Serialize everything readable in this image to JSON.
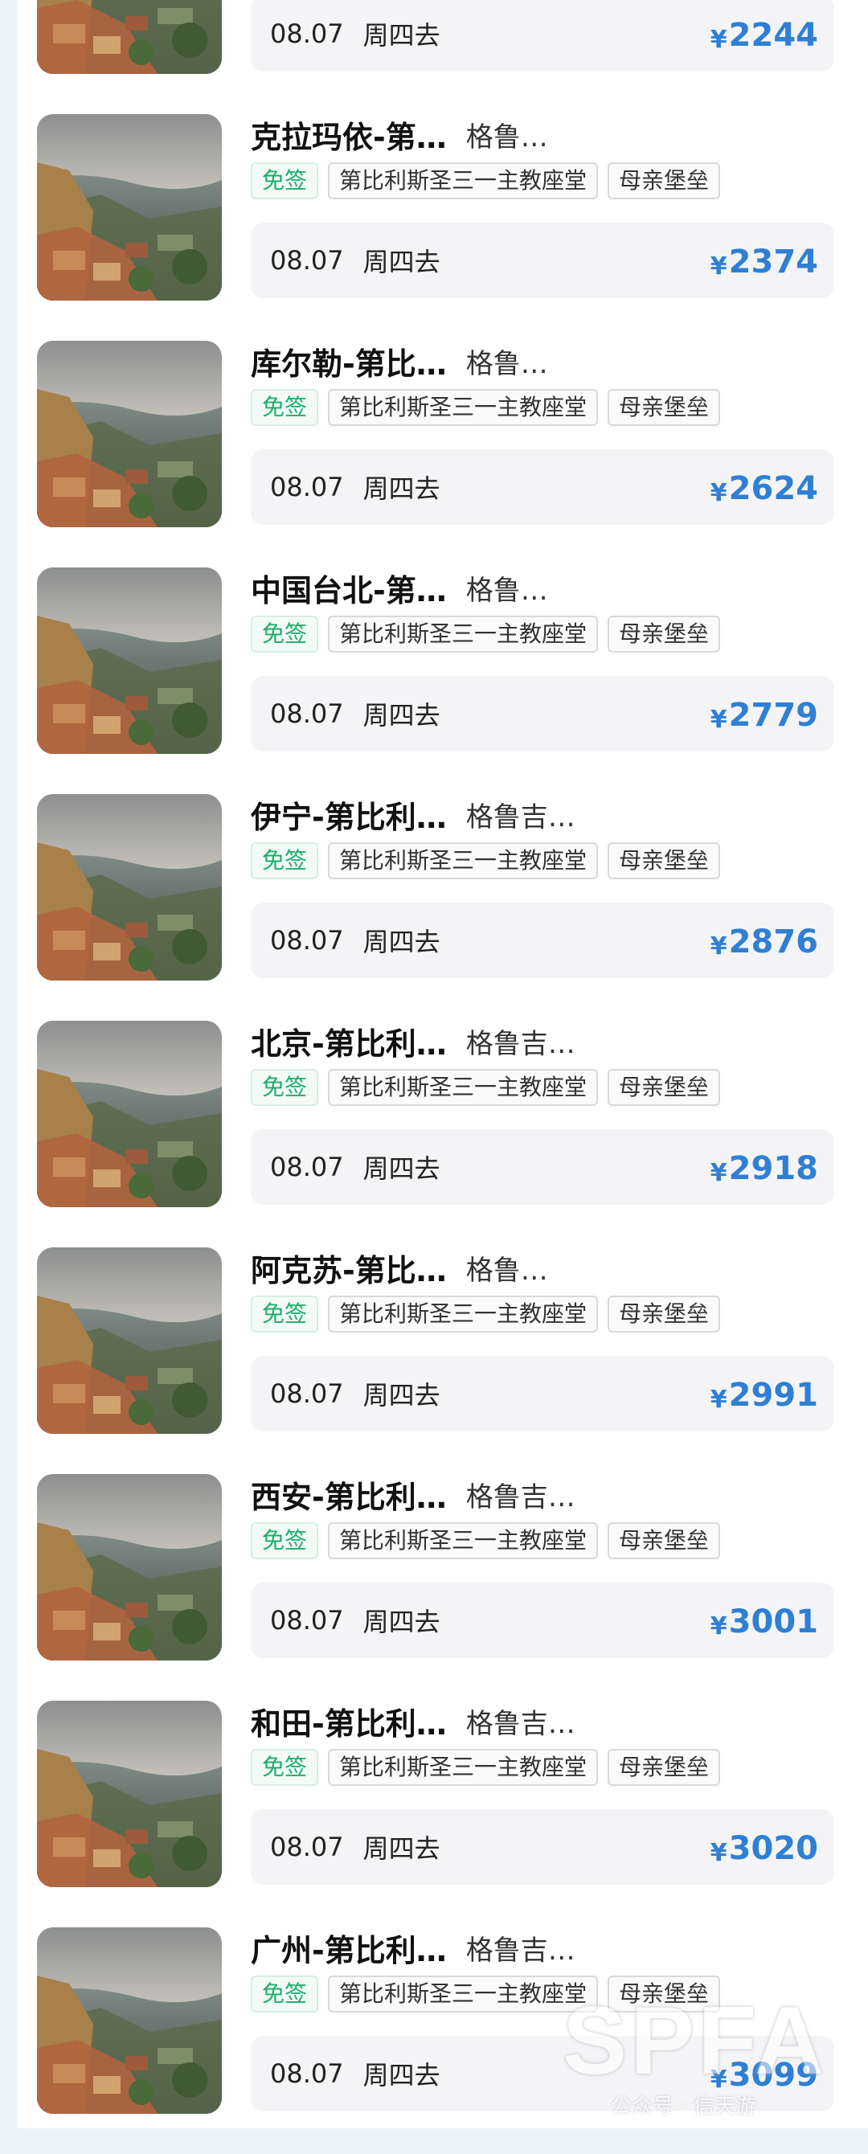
{
  "colors": {
    "price": "#2f7fd4",
    "visa_free_tag": "#1aad6a"
  },
  "thumbnail_icon": "tbilisi-city-view-photo",
  "top_partial": {
    "date": "08.07",
    "weekday": "周四去",
    "currency": "¥",
    "price": "2244"
  },
  "routes": [
    {
      "city": "克拉玛依-第…",
      "sub": "格鲁…",
      "tags": [
        "免签",
        "第比利斯圣三一主教座堂",
        "母亲堡垒"
      ],
      "date": "08.07",
      "weekday": "周四去",
      "currency": "¥",
      "price": "2374"
    },
    {
      "city": "库尔勒-第比…",
      "sub": "格鲁…",
      "tags": [
        "免签",
        "第比利斯圣三一主教座堂",
        "母亲堡垒"
      ],
      "date": "08.07",
      "weekday": "周四去",
      "currency": "¥",
      "price": "2624"
    },
    {
      "city": "中国台北-第…",
      "sub": "格鲁…",
      "tags": [
        "免签",
        "第比利斯圣三一主教座堂",
        "母亲堡垒"
      ],
      "date": "08.07",
      "weekday": "周四去",
      "currency": "¥",
      "price": "2779"
    },
    {
      "city": "伊宁-第比利…",
      "sub": "格鲁吉…",
      "tags": [
        "免签",
        "第比利斯圣三一主教座堂",
        "母亲堡垒"
      ],
      "date": "08.07",
      "weekday": "周四去",
      "currency": "¥",
      "price": "2876"
    },
    {
      "city": "北京-第比利…",
      "sub": "格鲁吉…",
      "tags": [
        "免签",
        "第比利斯圣三一主教座堂",
        "母亲堡垒"
      ],
      "date": "08.07",
      "weekday": "周四去",
      "currency": "¥",
      "price": "2918"
    },
    {
      "city": "阿克苏-第比…",
      "sub": "格鲁…",
      "tags": [
        "免签",
        "第比利斯圣三一主教座堂",
        "母亲堡垒"
      ],
      "date": "08.07",
      "weekday": "周四去",
      "currency": "¥",
      "price": "2991"
    },
    {
      "city": "西安-第比利…",
      "sub": "格鲁吉…",
      "tags": [
        "免签",
        "第比利斯圣三一主教座堂",
        "母亲堡垒"
      ],
      "date": "08.07",
      "weekday": "周四去",
      "currency": "¥",
      "price": "3001"
    },
    {
      "city": "和田-第比利…",
      "sub": "格鲁吉…",
      "tags": [
        "免签",
        "第比利斯圣三一主教座堂",
        "母亲堡垒"
      ],
      "date": "08.07",
      "weekday": "周四去",
      "currency": "¥",
      "price": "3020"
    },
    {
      "city": "广州-第比利…",
      "sub": "格鲁吉…",
      "tags": [
        "免签",
        "第比利斯圣三一主教座堂",
        "母亲堡垒"
      ],
      "date": "08.07",
      "weekday": "周四去",
      "currency": "¥",
      "price": "3099"
    }
  ],
  "watermark": {
    "logo": "SPFA",
    "caption": "公众号 · 信天游"
  }
}
